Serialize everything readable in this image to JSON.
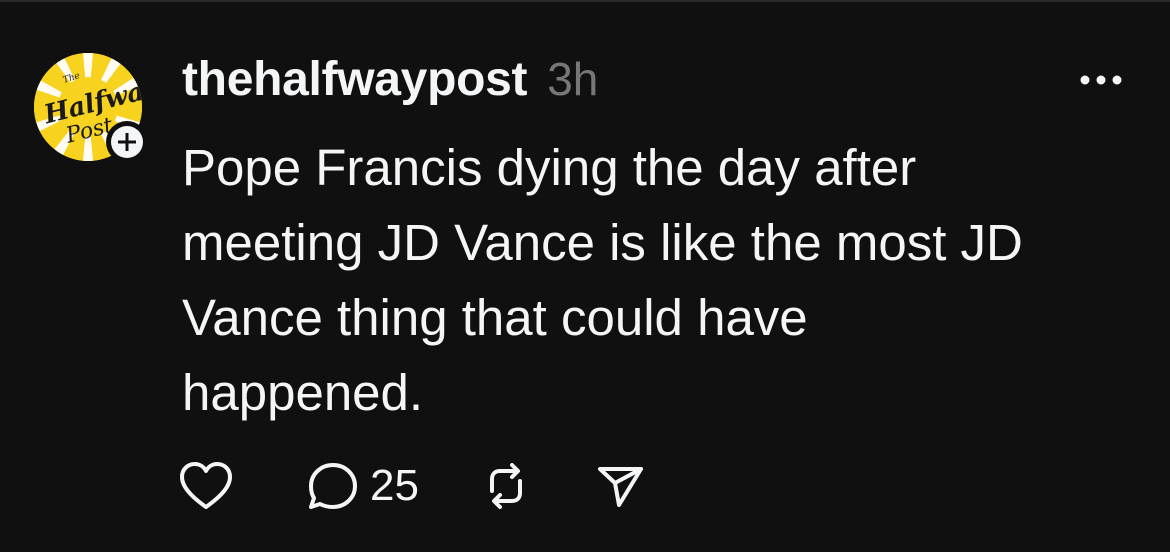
{
  "post": {
    "author": {
      "username": "thehalfwaypost",
      "avatar_logo_text": "The Halfway Post"
    },
    "timestamp": "3h",
    "text_lines": [
      "Pope Francis dying the day after",
      "meeting JD Vance is like the most JD",
      "Vance thing that could have",
      "happened."
    ],
    "actions": {
      "reply_count": "25"
    },
    "icons": {
      "follow": "plus-icon",
      "more": "more-options-icon",
      "like": "heart-icon",
      "reply": "comment-icon",
      "repost": "repost-icon",
      "share": "send-icon"
    }
  },
  "colors": {
    "background": "#101010",
    "text_primary": "#f3f5f7",
    "text_secondary": "#777777",
    "avatar_yellow": "#f7d21e"
  }
}
